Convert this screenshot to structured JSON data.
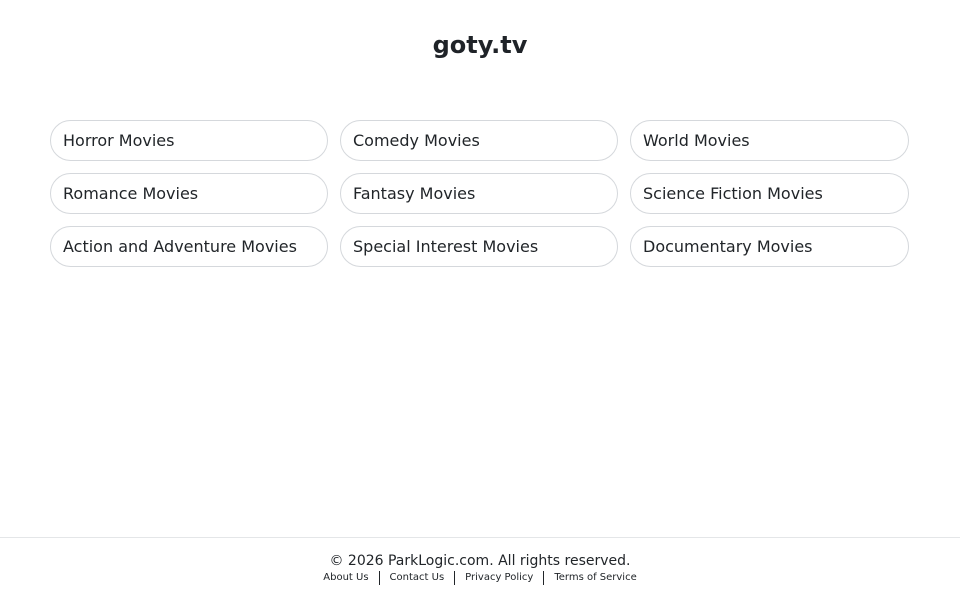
{
  "site": {
    "title": "goty.tv"
  },
  "categories": [
    {
      "label": "Horror Movies"
    },
    {
      "label": "Comedy Movies"
    },
    {
      "label": "World Movies"
    },
    {
      "label": "Romance Movies"
    },
    {
      "label": "Fantasy Movies"
    },
    {
      "label": "Science Fiction Movies"
    },
    {
      "label": "Action and Adventure Movies"
    },
    {
      "label": "Special Interest Movies"
    },
    {
      "label": "Documentary Movies"
    }
  ],
  "footer": {
    "copyright": "© 2026 ParkLogic.com. All rights reserved.",
    "links": [
      {
        "label": "About Us"
      },
      {
        "label": "Contact Us"
      },
      {
        "label": "Privacy Policy"
      },
      {
        "label": "Terms of Service"
      }
    ]
  }
}
